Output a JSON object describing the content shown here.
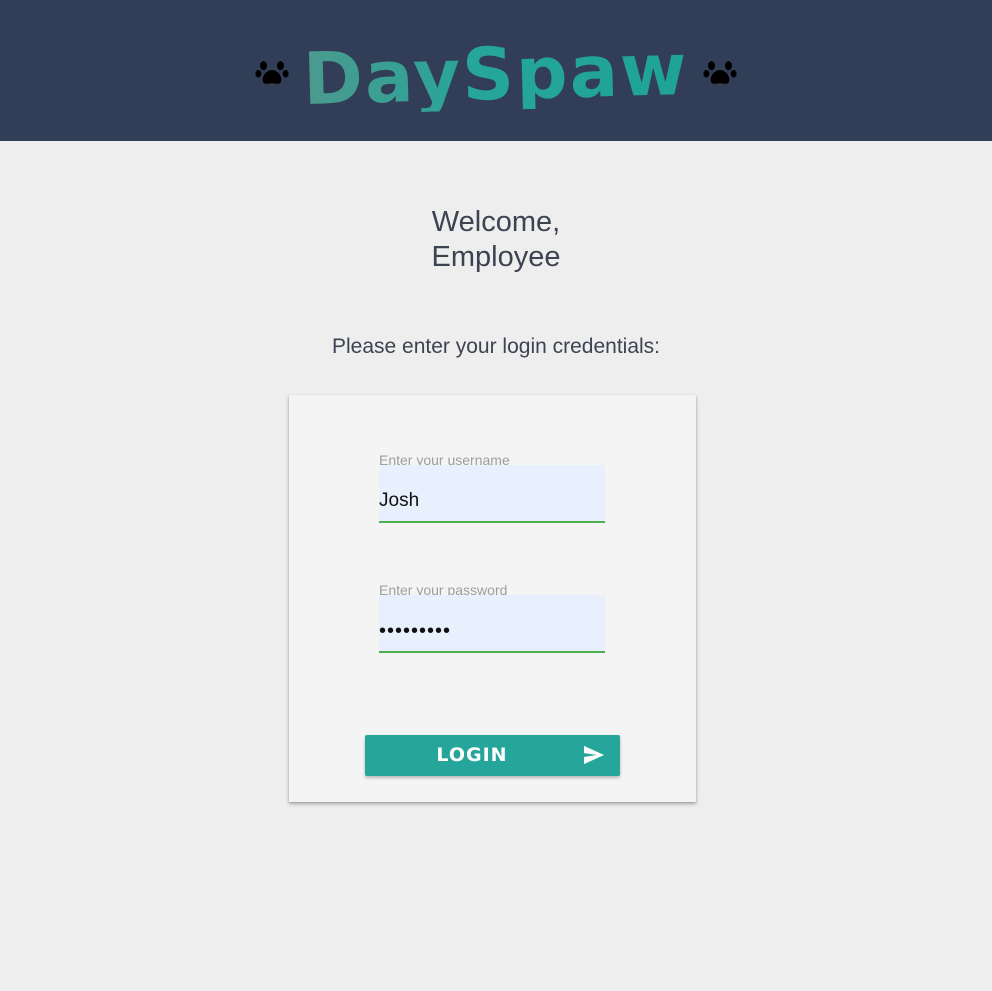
{
  "header": {
    "brand_title": "DaySpaw",
    "left_icon": "paw-icon",
    "right_icon": "paw-icon",
    "background_color": "#323e57",
    "brand_color": "#26a69a"
  },
  "welcome": {
    "line1": "Welcome,",
    "line2": "Employee"
  },
  "prompt": "Please enter your login credentials:",
  "form": {
    "username": {
      "label": "Enter your username",
      "value": "Josh"
    },
    "password": {
      "label": "Enter your password",
      "value": "•••••••••"
    },
    "login_button": {
      "label": "LOGIN",
      "icon": "send-icon",
      "color": "#26a69a"
    },
    "field_underline_color": "#4caf50",
    "field_fill_color": "#e8f0fe"
  }
}
